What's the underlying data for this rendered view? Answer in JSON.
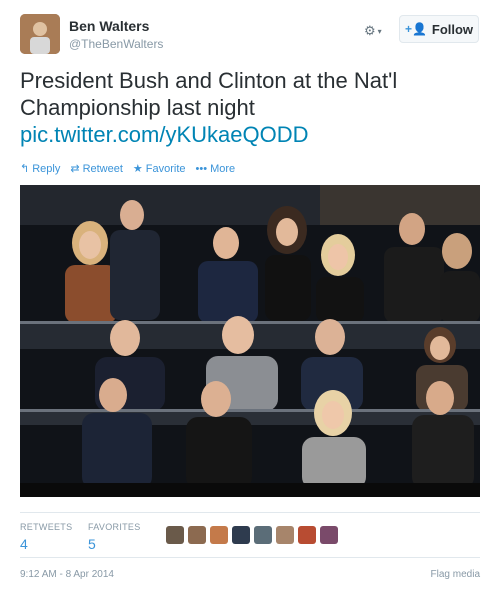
{
  "user": {
    "display_name": "Ben Walters",
    "screen_name": "@TheBenWalters"
  },
  "header": {
    "gear_icon": "gear-icon",
    "follow_label": "Follow"
  },
  "tweet": {
    "text": "President Bush and Clinton at the Nat'l Championship last night",
    "link": "pic.twitter.com/yKUkaeQODD"
  },
  "actions": [
    {
      "label": "Reply",
      "icon": "reply-icon"
    },
    {
      "label": "Retweet",
      "icon": "retweet-icon"
    },
    {
      "label": "Favorite",
      "icon": "star-icon"
    },
    {
      "label": "More",
      "icon": "more-icon"
    }
  ],
  "stats": {
    "retweets_label": "RETWEETS",
    "retweets_count": "4",
    "favorites_label": "FAVORITES",
    "favorites_count": "5"
  },
  "footer": {
    "timestamp": "9:12 AM - 8 Apr 2014",
    "flag_media": "Flag media"
  },
  "colors": {
    "link": "#0084b4",
    "action_blue": "#3b94d9",
    "muted": "#8899a6"
  }
}
